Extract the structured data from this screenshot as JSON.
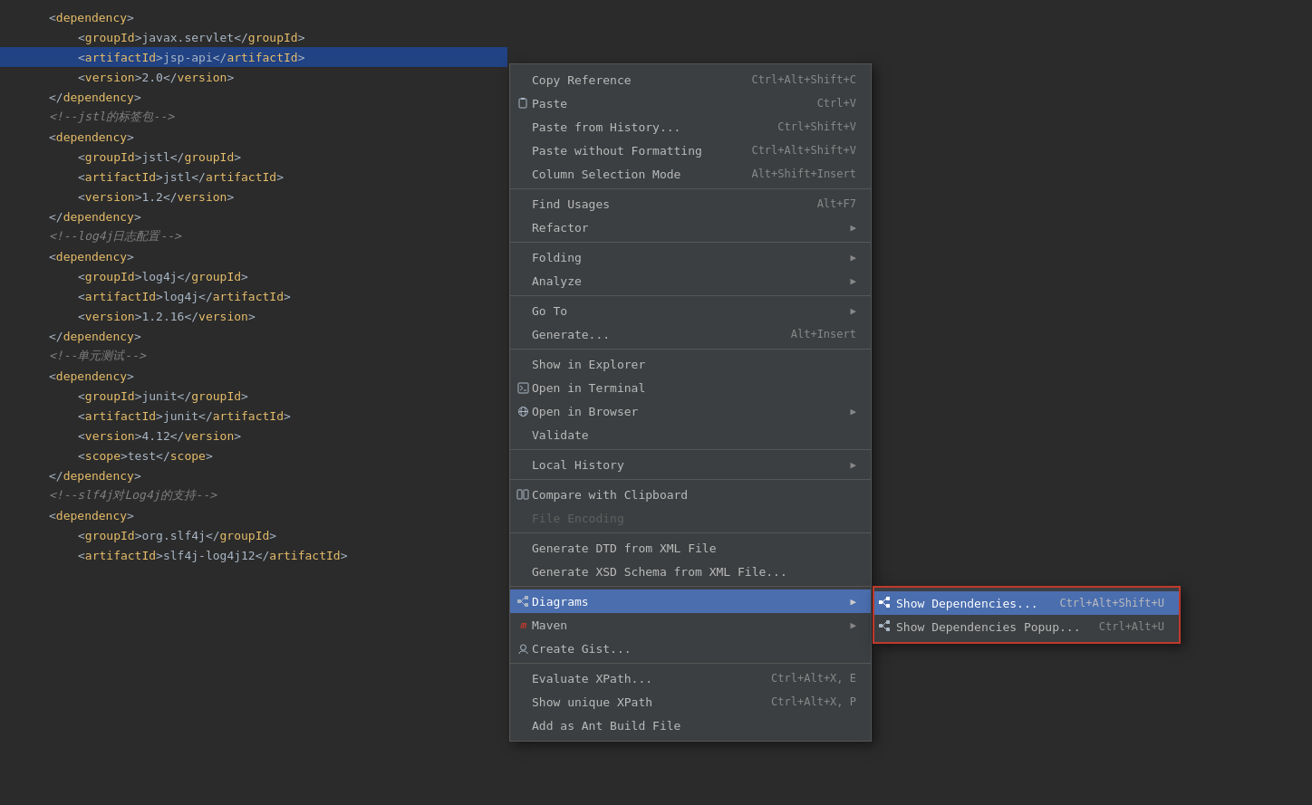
{
  "editor": {
    "lines": [
      {
        "num": "",
        "indent": 0,
        "content": "<dependency>",
        "type": "tag-line"
      },
      {
        "num": "",
        "indent": 1,
        "html": "&lt;<span class='tag'>groupId</span>&gt;javax.servlet&lt;/<span class='tag'>groupId</span>&gt;"
      },
      {
        "num": "",
        "indent": 1,
        "html": "&lt;<span class='tag'>artifactId</span>&gt;jsp-api&lt;/<span class='tag'>artifactId</span>&gt;",
        "selected": true
      },
      {
        "num": "",
        "indent": 1,
        "html": "&lt;<span class='tag'>version</span>&gt;2.0&lt;/<span class='tag'>version</span>&gt;"
      },
      {
        "num": "",
        "indent": 0,
        "html": "&lt;/<span class='tag'>dependency</span>&gt;"
      },
      {
        "num": "",
        "indent": 0,
        "html": "<span class='comment'>&lt;!--jstl的标签包--&gt;</span>"
      },
      {
        "num": "",
        "indent": 0,
        "html": "&lt;<span class='tag'>dependency</span>&gt;"
      },
      {
        "num": "",
        "indent": 1,
        "html": "&lt;<span class='tag'>groupId</span>&gt;jstl&lt;/<span class='tag'>groupId</span>&gt;"
      },
      {
        "num": "",
        "indent": 1,
        "html": "&lt;<span class='tag'>artifactId</span>&gt;jstl&lt;/<span class='tag'>artifactId</span>&gt;"
      },
      {
        "num": "",
        "indent": 1,
        "html": "&lt;<span class='tag'>version</span>&gt;1.2&lt;/<span class='tag'>version</span>&gt;"
      },
      {
        "num": "",
        "indent": 0,
        "html": "&lt;/<span class='tag'>dependency</span>&gt;"
      },
      {
        "num": "",
        "indent": 0,
        "html": "<span class='comment'>&lt;!--log4j日志配置--&gt;</span>"
      },
      {
        "num": "",
        "indent": 0,
        "html": "&lt;<span class='tag'>dependency</span>&gt;"
      },
      {
        "num": "",
        "indent": 1,
        "html": "&lt;<span class='tag'>groupId</span>&gt;log4j&lt;/<span class='tag'>groupId</span>&gt;"
      },
      {
        "num": "",
        "indent": 1,
        "html": "&lt;<span class='tag'>artifactId</span>&gt;log4j&lt;/<span class='tag'>artifactId</span>&gt;"
      },
      {
        "num": "",
        "indent": 1,
        "html": "&lt;<span class='tag'>version</span>&gt;1.2.16&lt;/<span class='tag'>version</span>&gt;"
      },
      {
        "num": "",
        "indent": 0,
        "html": "&lt;/<span class='tag'>dependency</span>&gt;"
      },
      {
        "num": "",
        "indent": 0,
        "html": "<span class='comment'>&lt;!--单元测试--&gt;</span>"
      },
      {
        "num": "",
        "indent": 0,
        "html": "&lt;<span class='tag'>dependency</span>&gt;"
      },
      {
        "num": "",
        "indent": 1,
        "html": "&lt;<span class='tag'>groupId</span>&gt;junit&lt;/<span class='tag'>groupId</span>&gt;"
      },
      {
        "num": "",
        "indent": 1,
        "html": "&lt;<span class='tag'>artifactId</span>&gt;junit&lt;/<span class='tag'>artifactId</span>&gt;"
      },
      {
        "num": "",
        "indent": 1,
        "html": "&lt;<span class='tag'>version</span>&gt;4.12&lt;/<span class='tag'>version</span>&gt;"
      },
      {
        "num": "",
        "indent": 1,
        "html": "&lt;<span class='tag'>scope</span>&gt;test&lt;/<span class='tag'>scope</span>&gt;"
      },
      {
        "num": "",
        "indent": 0,
        "html": "&lt;/<span class='tag'>dependency</span>&gt;"
      },
      {
        "num": "",
        "indent": 0,
        "html": "<span class='comment'>&lt;!--slf4j对Log4j的支持--&gt;</span>"
      },
      {
        "num": "",
        "indent": 0,
        "html": "&lt;<span class='tag'>dependency</span>&gt;"
      },
      {
        "num": "",
        "indent": 1,
        "html": "&lt;<span class='tag'>groupId</span>&gt;org.slf4j&lt;/<span class='tag'>groupId</span>&gt;"
      },
      {
        "num": "",
        "indent": 1,
        "html": "&lt;<span class='tag'>artifactId</span>&gt;slf4j-log4j12&lt;/<span class='tag'>artifactId</span>&gt;"
      }
    ]
  },
  "contextMenu": {
    "items": [
      {
        "id": "copy-reference",
        "label": "Copy Reference",
        "shortcut": "Ctrl+Alt+Shift+C",
        "hasArrow": false,
        "icon": ""
      },
      {
        "id": "paste",
        "label": "Paste",
        "shortcut": "Ctrl+V",
        "hasArrow": false,
        "icon": "paste"
      },
      {
        "id": "paste-history",
        "label": "Paste from History...",
        "shortcut": "Ctrl+Shift+V",
        "hasArrow": false,
        "icon": ""
      },
      {
        "id": "paste-no-format",
        "label": "Paste without Formatting",
        "shortcut": "Ctrl+Alt+Shift+V",
        "hasArrow": false,
        "icon": ""
      },
      {
        "id": "column-selection",
        "label": "Column Selection Mode",
        "shortcut": "Alt+Shift+Insert",
        "hasArrow": false,
        "icon": ""
      },
      {
        "separator": true
      },
      {
        "id": "find-usages",
        "label": "Find Usages",
        "shortcut": "Alt+F7",
        "hasArrow": false,
        "icon": ""
      },
      {
        "id": "refactor",
        "label": "Refactor",
        "shortcut": "",
        "hasArrow": true,
        "icon": ""
      },
      {
        "separator": true
      },
      {
        "id": "folding",
        "label": "Folding",
        "shortcut": "",
        "hasArrow": true,
        "icon": ""
      },
      {
        "id": "analyze",
        "label": "Analyze",
        "shortcut": "",
        "hasArrow": true,
        "icon": ""
      },
      {
        "separator": true
      },
      {
        "id": "go-to",
        "label": "Go To",
        "shortcut": "",
        "hasArrow": true,
        "icon": ""
      },
      {
        "id": "generate",
        "label": "Generate...",
        "shortcut": "Alt+Insert",
        "hasArrow": false,
        "icon": ""
      },
      {
        "separator": true
      },
      {
        "id": "show-explorer",
        "label": "Show in Explorer",
        "shortcut": "",
        "hasArrow": false,
        "icon": ""
      },
      {
        "id": "open-terminal",
        "label": "Open in Terminal",
        "shortcut": "",
        "hasArrow": false,
        "icon": "terminal"
      },
      {
        "id": "open-browser",
        "label": "Open in Browser",
        "shortcut": "",
        "hasArrow": true,
        "icon": "browser"
      },
      {
        "id": "validate",
        "label": "Validate",
        "shortcut": "",
        "hasArrow": false,
        "icon": ""
      },
      {
        "separator": true
      },
      {
        "id": "local-history",
        "label": "Local History",
        "shortcut": "",
        "hasArrow": true,
        "icon": ""
      },
      {
        "separator": true
      },
      {
        "id": "compare-clipboard",
        "label": "Compare with Clipboard",
        "shortcut": "",
        "hasArrow": false,
        "icon": "compare"
      },
      {
        "id": "file-encoding",
        "label": "File Encoding",
        "shortcut": "",
        "hasArrow": false,
        "icon": "",
        "disabled": true
      },
      {
        "separator": true
      },
      {
        "id": "generate-dtd",
        "label": "Generate DTD from XML File",
        "shortcut": "",
        "hasArrow": false,
        "icon": ""
      },
      {
        "id": "generate-xsd",
        "label": "Generate XSD Schema from XML File...",
        "shortcut": "",
        "hasArrow": false,
        "icon": ""
      },
      {
        "separator": true
      },
      {
        "id": "diagrams",
        "label": "Diagrams",
        "shortcut": "",
        "hasArrow": true,
        "icon": "diagram",
        "highlighted": true
      },
      {
        "separator": false
      },
      {
        "id": "maven",
        "label": "Maven",
        "shortcut": "",
        "hasArrow": true,
        "icon": "maven"
      },
      {
        "id": "create-gist",
        "label": "Create Gist...",
        "shortcut": "",
        "hasArrow": false,
        "icon": "github"
      },
      {
        "separator": true
      },
      {
        "id": "evaluate-xpath",
        "label": "Evaluate XPath...",
        "shortcut": "Ctrl+Alt+X, E",
        "hasArrow": false,
        "icon": ""
      },
      {
        "id": "show-unique-xpath",
        "label": "Show unique XPath",
        "shortcut": "Ctrl+Alt+X, P",
        "hasArrow": false,
        "icon": ""
      },
      {
        "id": "add-ant-build",
        "label": "Add as Ant Build File",
        "shortcut": "",
        "hasArrow": false,
        "icon": ""
      }
    ]
  },
  "submenu": {
    "items": [
      {
        "id": "show-deps",
        "label": "Show Dependencies...",
        "shortcut": "Ctrl+Alt+Shift+U",
        "highlighted": true,
        "icon": "diagram"
      },
      {
        "id": "show-deps-popup",
        "label": "Show Dependencies Popup...",
        "shortcut": "Ctrl+Alt+U",
        "icon": "diagram"
      }
    ]
  }
}
